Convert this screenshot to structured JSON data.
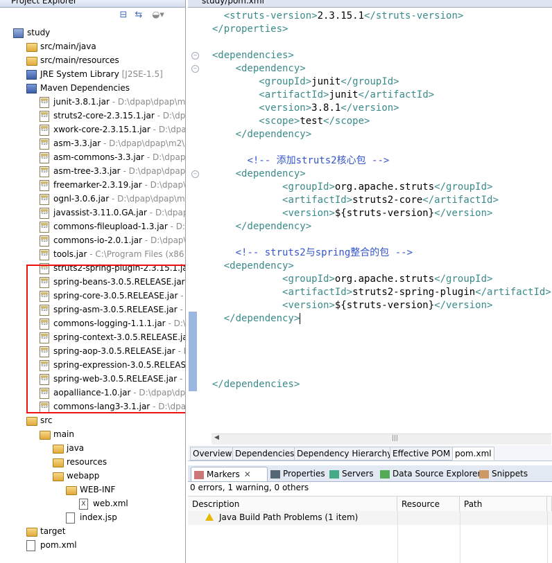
{
  "project_explorer": {
    "title": "Project Explorer",
    "tree": [
      {
        "depth": 0,
        "icon": "project-icon",
        "label": "study",
        "decoration": ""
      },
      {
        "depth": 1,
        "icon": "source-folder-icon",
        "label": "src/main/java",
        "decoration": ""
      },
      {
        "depth": 1,
        "icon": "source-folder-icon",
        "label": "src/main/resources",
        "decoration": ""
      },
      {
        "depth": 1,
        "icon": "library-icon",
        "label": "JRE System Library",
        "decoration": " [J2SE-1.5]"
      },
      {
        "depth": 1,
        "icon": "library-icon",
        "label": "Maven Dependencies",
        "decoration": ""
      },
      {
        "depth": 2,
        "icon": "jar-icon",
        "label": "junit-3.8.1.jar",
        "decoration": " - D:\\dpap\\dpap\\m"
      },
      {
        "depth": 2,
        "icon": "jar-icon",
        "label": "struts2-core-2.3.15.1.jar",
        "decoration": " - D:\\dpa"
      },
      {
        "depth": 2,
        "icon": "jar-icon",
        "label": "xwork-core-2.3.15.1.jar",
        "decoration": " - D:\\dpa"
      },
      {
        "depth": 2,
        "icon": "jar-icon",
        "label": "asm-3.3.jar",
        "decoration": " - D:\\dpap\\dpap\\m2\\"
      },
      {
        "depth": 2,
        "icon": "jar-icon",
        "label": "asm-commons-3.3.jar",
        "decoration": " - D:\\dpap"
      },
      {
        "depth": 2,
        "icon": "jar-icon",
        "label": "asm-tree-3.3.jar",
        "decoration": " - D:\\dpap\\dpap"
      },
      {
        "depth": 2,
        "icon": "jar-icon",
        "label": "freemarker-2.3.19.jar",
        "decoration": " - D:\\dpap\\"
      },
      {
        "depth": 2,
        "icon": "jar-icon",
        "label": "ognl-3.0.6.jar",
        "decoration": " - D:\\dpap\\dpap\\m"
      },
      {
        "depth": 2,
        "icon": "jar-icon",
        "label": "javassist-3.11.0.GA.jar",
        "decoration": " - D:\\dpap\\"
      },
      {
        "depth": 2,
        "icon": "jar-icon",
        "label": "commons-fileupload-1.3.jar",
        "decoration": " - D:\\"
      },
      {
        "depth": 2,
        "icon": "jar-icon",
        "label": "commons-io-2.0.1.jar",
        "decoration": " - D:\\dpap\\"
      },
      {
        "depth": 2,
        "icon": "jar-icon",
        "label": "tools.jar",
        "decoration": " - C:\\Program Files (x86)"
      },
      {
        "depth": 2,
        "icon": "jar-icon",
        "label": "struts2-spring-plugin-2.3.15.1.jar",
        "decoration": ""
      },
      {
        "depth": 2,
        "icon": "jar-icon",
        "label": "spring-beans-3.0.5.RELEASE.jar",
        "decoration": " - D"
      },
      {
        "depth": 2,
        "icon": "jar-icon",
        "label": "spring-core-3.0.5.RELEASE.jar",
        "decoration": " - D"
      },
      {
        "depth": 2,
        "icon": "jar-icon",
        "label": "spring-asm-3.0.5.RELEASE.jar",
        "decoration": " - D"
      },
      {
        "depth": 2,
        "icon": "jar-icon",
        "label": "commons-logging-1.1.1.jar",
        "decoration": " - D:\\"
      },
      {
        "depth": 2,
        "icon": "jar-icon",
        "label": "spring-context-3.0.5.RELEASE.jar",
        "decoration": ""
      },
      {
        "depth": 2,
        "icon": "jar-icon",
        "label": "spring-aop-3.0.5.RELEASE.jar",
        "decoration": " - D"
      },
      {
        "depth": 2,
        "icon": "jar-icon",
        "label": "spring-expression-3.0.5.RELEASE",
        "decoration": ""
      },
      {
        "depth": 2,
        "icon": "jar-icon",
        "label": "spring-web-3.0.5.RELEASE.jar",
        "decoration": " - D"
      },
      {
        "depth": 2,
        "icon": "jar-icon",
        "label": "aopalliance-1.0.jar",
        "decoration": " - D:\\dpap\\dp"
      },
      {
        "depth": 2,
        "icon": "jar-icon",
        "label": "commons-lang3-3.1.jar",
        "decoration": " - D:\\dpa"
      },
      {
        "depth": 1,
        "icon": "folder-icon",
        "label": "src",
        "decoration": ""
      },
      {
        "depth": 2,
        "icon": "folder-icon",
        "label": "main",
        "decoration": ""
      },
      {
        "depth": 3,
        "icon": "folder-icon",
        "label": "java",
        "decoration": ""
      },
      {
        "depth": 3,
        "icon": "folder-icon",
        "label": "resources",
        "decoration": ""
      },
      {
        "depth": 3,
        "icon": "folder-icon",
        "label": "webapp",
        "decoration": ""
      },
      {
        "depth": 4,
        "icon": "folder-icon",
        "label": "WEB-INF",
        "decoration": ""
      },
      {
        "depth": 5,
        "icon": "xml-file-icon",
        "label": "web.xml",
        "decoration": ""
      },
      {
        "depth": 4,
        "icon": "jsp-file-icon",
        "label": "index.jsp",
        "decoration": ""
      },
      {
        "depth": 1,
        "icon": "folder-icon",
        "label": "target",
        "decoration": ""
      },
      {
        "depth": 1,
        "icon": "xml-file-icon",
        "label": "pom.xml",
        "decoration": ""
      }
    ]
  },
  "editor": {
    "tab_title": "study/pom.xml",
    "lines": [
      {
        "indent": "  ",
        "fold": false,
        "parts": [
          [
            "t",
            "<struts-version>"
          ],
          [
            "v",
            "2.3.15.1"
          ],
          [
            "t",
            "</struts-version>"
          ]
        ]
      },
      {
        "indent": " ",
        "fold": false,
        "parts": [
          [
            "t",
            "</properties>"
          ]
        ]
      },
      {
        "indent": "",
        "fold": false,
        "parts": []
      },
      {
        "indent": " ",
        "fold": true,
        "parts": [
          [
            "t",
            "<dependencies>"
          ]
        ]
      },
      {
        "indent": "   ",
        "fold": true,
        "parts": [
          [
            "t",
            "<dependency>"
          ]
        ]
      },
      {
        "indent": "     ",
        "fold": false,
        "parts": [
          [
            "t",
            "<groupId>"
          ],
          [
            "v",
            "junit"
          ],
          [
            "t",
            "</groupId>"
          ]
        ]
      },
      {
        "indent": "     ",
        "fold": false,
        "parts": [
          [
            "t",
            "<artifactId>"
          ],
          [
            "v",
            "junit"
          ],
          [
            "t",
            "</artifactId>"
          ]
        ]
      },
      {
        "indent": "     ",
        "fold": false,
        "parts": [
          [
            "t",
            "<version>"
          ],
          [
            "v",
            "3.8.1"
          ],
          [
            "t",
            "</version>"
          ]
        ]
      },
      {
        "indent": "     ",
        "fold": false,
        "parts": [
          [
            "t",
            "<scope>"
          ],
          [
            "v",
            "test"
          ],
          [
            "t",
            "</scope>"
          ]
        ]
      },
      {
        "indent": "   ",
        "fold": false,
        "parts": [
          [
            "t",
            "</dependency>"
          ]
        ]
      },
      {
        "indent": "",
        "fold": false,
        "parts": []
      },
      {
        "indent": "    ",
        "fold": false,
        "parts": [
          [
            "c",
            "<!-- 添加struts2核心包 -->"
          ]
        ]
      },
      {
        "indent": "   ",
        "fold": true,
        "parts": [
          [
            "t",
            "<dependency>"
          ]
        ]
      },
      {
        "indent": "       ",
        "fold": false,
        "parts": [
          [
            "t",
            "<groupId>"
          ],
          [
            "v",
            "org.apache.struts"
          ],
          [
            "t",
            "</groupId>"
          ]
        ]
      },
      {
        "indent": "       ",
        "fold": false,
        "parts": [
          [
            "t",
            "<artifactId>"
          ],
          [
            "v",
            "struts2-core"
          ],
          [
            "t",
            "</artifactId>"
          ]
        ]
      },
      {
        "indent": "       ",
        "fold": false,
        "parts": [
          [
            "t",
            "<version>"
          ],
          [
            "v",
            "${struts-version}"
          ],
          [
            "t",
            "</version>"
          ]
        ]
      },
      {
        "indent": "   ",
        "fold": false,
        "parts": [
          [
            "t",
            "</dependency>"
          ]
        ]
      },
      {
        "indent": "",
        "fold": false,
        "parts": []
      },
      {
        "indent": "   ",
        "fold": false,
        "parts": [
          [
            "c",
            "<!-- struts2与spring整合的包 -->"
          ]
        ]
      },
      {
        "indent": "  ",
        "fold": false,
        "parts": [
          [
            "t",
            "<dependency>"
          ]
        ]
      },
      {
        "indent": "       ",
        "fold": false,
        "parts": [
          [
            "t",
            "<groupId>"
          ],
          [
            "v",
            "org.apache.struts"
          ],
          [
            "t",
            "</groupId>"
          ]
        ]
      },
      {
        "indent": "       ",
        "fold": false,
        "parts": [
          [
            "t",
            "<artifactId>"
          ],
          [
            "v",
            "struts2-spring-plugin"
          ],
          [
            "t",
            "</artifactId>"
          ]
        ]
      },
      {
        "indent": "       ",
        "fold": false,
        "parts": [
          [
            "t",
            "<version>"
          ],
          [
            "v",
            "${struts-version}"
          ],
          [
            "t",
            "</version>"
          ]
        ]
      },
      {
        "indent": "  ",
        "fold": false,
        "parts": [
          [
            "t",
            "</dependency>"
          ]
        ],
        "caret": true
      },
      {
        "indent": "",
        "fold": false,
        "parts": []
      },
      {
        "indent": "",
        "fold": false,
        "parts": []
      },
      {
        "indent": "",
        "fold": false,
        "parts": []
      },
      {
        "indent": "",
        "fold": false,
        "parts": []
      },
      {
        "indent": " ",
        "fold": false,
        "parts": [
          [
            "t",
            "</dependencies>"
          ]
        ]
      }
    ],
    "pom_tabs": [
      "Overview",
      "Dependencies",
      "Dependency Hierarchy",
      "Effective POM",
      "pom.xml"
    ],
    "active_pom_tab": 4
  },
  "views": {
    "tabs": [
      "Markers",
      "Properties",
      "Servers",
      "Data Source Explorer",
      "Snippets"
    ],
    "active_tab": 0,
    "status": "0 errors, 1 warning, 0 others",
    "columns": [
      "Description",
      "Resource",
      "Path",
      "L"
    ],
    "rows": [
      "Java Build Path Problems (1 item)"
    ]
  },
  "colors": {
    "xml_tag": "#3a8a8a",
    "xml_comment": "#3355cc",
    "highlight_box": "#e11111",
    "warning": "#e8b800"
  }
}
